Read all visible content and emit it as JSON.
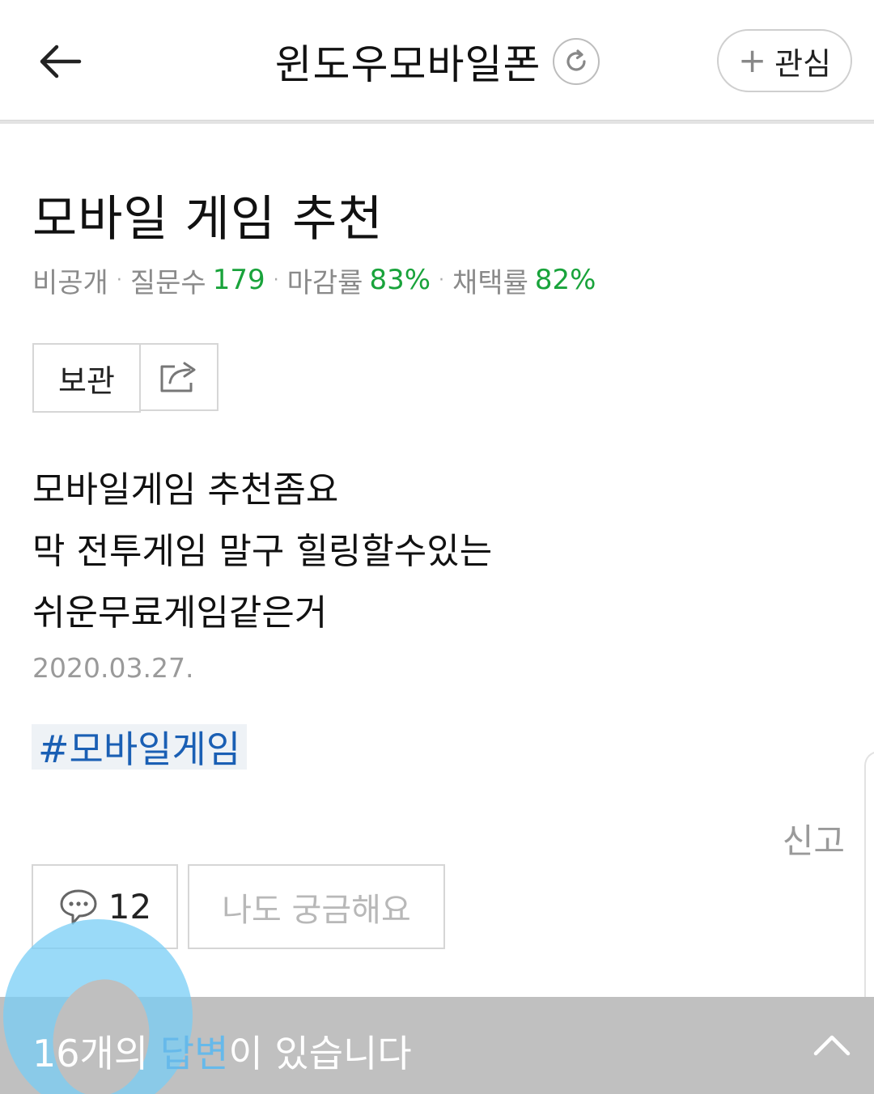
{
  "header": {
    "title": "윈도우모바일폰",
    "follow_plus": "+",
    "follow_label": "관심"
  },
  "question": {
    "title": "모바일 게임 추천",
    "meta": {
      "visibility": "비공개",
      "questions_label": "질문수",
      "questions_value": "179",
      "close_rate_label": "마감률",
      "close_rate_value": "83%",
      "adopt_rate_label": "채택률",
      "adopt_rate_value": "82%",
      "separator": "·"
    },
    "save_label": "보관",
    "body_lines": [
      "모바일게임 추천좀요",
      "막 전투게임 말구 힐링할수있는",
      "쉬운무료게임같은거"
    ],
    "date": "2020.03.27.",
    "tag": "#모바일게임",
    "report_label": "신고",
    "comment_count": "12",
    "curious_label": "나도 궁금해요"
  },
  "answers_bar": {
    "count_text": "16개의 ",
    "highlight_text": "답변",
    "rest_text": "이 있습니다"
  },
  "colors": {
    "accent_green": "#19a33b",
    "tag_blue": "#1a5fb4",
    "answer_bar_gray": "#c0c0c0",
    "touch_indicator": "#78cdf5"
  },
  "icons": {
    "back": "arrow-left-icon",
    "refresh": "refresh-icon",
    "share": "share-icon",
    "comment": "speech-bubble-icon",
    "expand": "chevron-up-icon"
  }
}
